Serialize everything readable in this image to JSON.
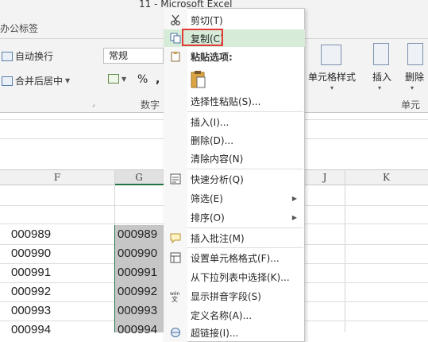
{
  "window": {
    "title": "11 - Microsoft Excel"
  },
  "ribbon": {
    "tab_label": "办公标签",
    "wrap_text": "自动换行",
    "merge_center": "合并后居中",
    "number_format": "常规",
    "percent": "%",
    "comma": ",",
    "number_group": "数字",
    "cell_styles": "单元格样式",
    "insert": "插入",
    "delete": "删除",
    "cells_group": "单元"
  },
  "sheet": {
    "columns": [
      "F",
      "G",
      "J",
      "K"
    ],
    "f_values": [
      "000989",
      "000990",
      "000991",
      "000992",
      "000993",
      "000994"
    ],
    "g_values": [
      "000989",
      "000990",
      "000991",
      "000992",
      "000993",
      "000994"
    ]
  },
  "context_menu": {
    "cut": "剪切(T)",
    "copy": "复制(C)",
    "paste_options": "粘贴选项:",
    "paste_special": "选择性粘贴(S)...",
    "insert": "插入(I)...",
    "delete": "删除(D)...",
    "clear": "清除内容(N)",
    "quick_analysis": "快速分析(Q)",
    "filter": "筛选(E)",
    "sort": "排序(O)",
    "insert_comment": "插入批注(M)",
    "format_cells": "设置单元格格式(F)...",
    "pick_list": "从下拉列表中选择(K)...",
    "phonetic": "显示拼音字段(S)",
    "define_name": "定义名称(A)...",
    "hyperlink": "超链接(I)..."
  },
  "colors": {
    "highlight": "#d6ecd9",
    "annotation_box": "#e53935",
    "selection": "#c6c6c6"
  }
}
